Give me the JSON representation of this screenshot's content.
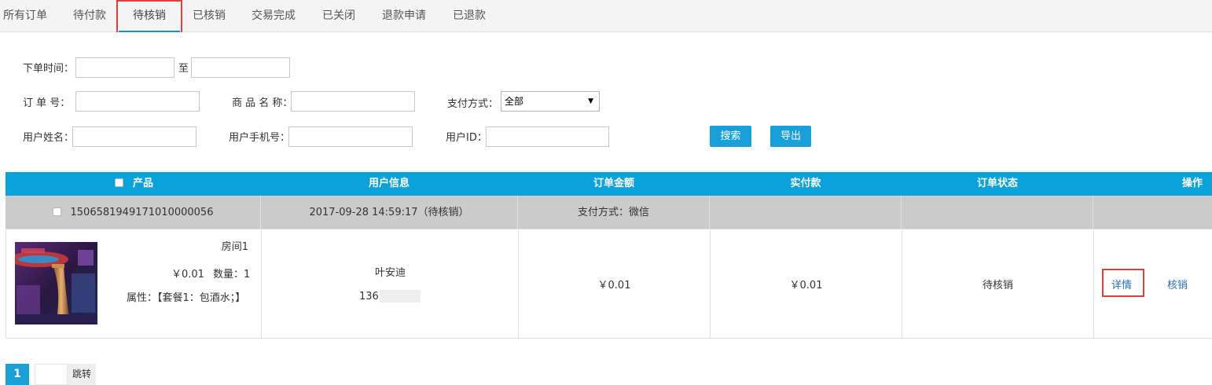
{
  "tabs": [
    {
      "label": "所有订单"
    },
    {
      "label": "待付款"
    },
    {
      "label": "待核销"
    },
    {
      "label": "已核销"
    },
    {
      "label": "交易完成"
    },
    {
      "label": "已关闭"
    },
    {
      "label": "退款申请"
    },
    {
      "label": "已退款"
    }
  ],
  "active_tab": "待核销",
  "filters": {
    "order_time_label": "下单时间：",
    "to_label": "至",
    "order_no_label": "订 单 号：",
    "product_name_label": "商 品 名 称：",
    "pay_method_label": "支付方式：",
    "pay_method_value": "全部",
    "user_name_label": "用户姓名：",
    "user_phone_label": "用户手机号：",
    "user_id_label": "用户ID："
  },
  "buttons": {
    "search": "搜索",
    "export": "导出"
  },
  "table": {
    "headers": {
      "product": "产品",
      "user_info": "用户信息",
      "order_amount": "订单金额",
      "paid": "实付款",
      "status": "订单状态",
      "action": "操作"
    },
    "order": {
      "order_no": "15065819491710100000​56",
      "time_status": "2017-09-28 14:59:17（待核销）",
      "pay_method": "支付方式：微信",
      "product_name": "房间1",
      "price": "￥0.01",
      "quantity": "数量：1",
      "attributes": "属性：【套餐1：包酒水；】",
      "user_name": "叶安迪",
      "user_phone": "136",
      "order_amount": "￥0.01",
      "paid_amount": "￥0.01",
      "status": "待核销",
      "detail_link": "详情",
      "verify_link": "核销"
    }
  },
  "pagination": {
    "current_page": "1",
    "jump_label": "跳转"
  },
  "colors": {
    "accent": "#0aa2da",
    "highlight": "#e0403a",
    "link": "#2a6fb8"
  }
}
